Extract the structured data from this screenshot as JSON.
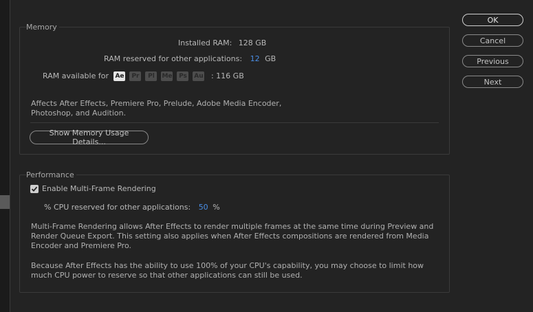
{
  "memory": {
    "group_label": "Memory",
    "installed_ram_label": "Installed RAM:",
    "installed_ram_value": "128 GB",
    "reserved_label": "RAM reserved for other applications:",
    "reserved_value": "12",
    "reserved_unit": "GB",
    "available_label": "RAM available for",
    "apps": [
      "Ae",
      "Pr",
      "Pl",
      "Me",
      "Ps",
      "Au"
    ],
    "available_value": ": 116 GB",
    "note_line1": "Affects After Effects, Premiere Pro, Prelude, Adobe Media Encoder,",
    "note_line2": "Photoshop, and Audition.",
    "details_button": "Show Memory Usage Details..."
  },
  "performance": {
    "group_label": "Performance",
    "mfr_checkbox_label": "Enable Multi-Frame Rendering",
    "mfr_checked": true,
    "cpu_label": "% CPU reserved for other applications:",
    "cpu_value": "50",
    "cpu_unit": "%",
    "para1_line1": "Multi-Frame Rendering allows After Effects to render multiple frames at the same time during Preview and",
    "para1_line2": "Render Queue Export. This setting also applies when After Effects compositions are rendered from Media",
    "para1_line3": "Encoder and Premiere Pro.",
    "para2_line1": "Because After Effects has the ability to use 100% of your CPU's capability, you may choose to limit how",
    "para2_line2": "much CPU power to reserve so that other applications can still be used."
  },
  "dialog_buttons": {
    "ok": "OK",
    "cancel": "Cancel",
    "previous": "Previous",
    "next": "Next"
  },
  "colors": {
    "background": "#232323",
    "accent_value": "#4a8ee6",
    "text": "#b8b8b8"
  }
}
